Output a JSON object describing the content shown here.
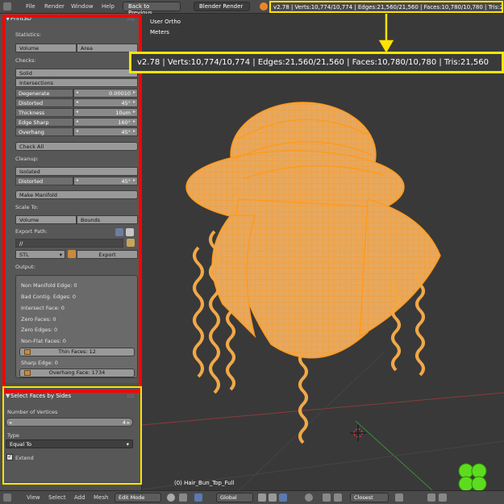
{
  "topbar": {
    "menus": [
      "File",
      "Render",
      "Window",
      "Help"
    ],
    "back_button": "Back to Previous",
    "render_engine": "Blender Render",
    "stats": "v2.78 | Verts:10,774/10,774 | Edges:21,560/21,560 | Faces:10,780/10,780 | Tris:21,560"
  },
  "print3d": {
    "title": "Print3D",
    "statistics_label": "Statistics:",
    "volume_button": "Volume",
    "area_button": "Area",
    "checks_label": "Checks:",
    "solid_button": "Solid",
    "intersections_button": "Intersections",
    "fields": [
      {
        "label": "Degenerate",
        "value": "0.00010"
      },
      {
        "label": "Distorted",
        "value": "45°"
      },
      {
        "label": "Thickness",
        "value": "10um"
      },
      {
        "label": "Edge Sharp",
        "value": "160°"
      },
      {
        "label": "Overhang",
        "value": "45°"
      }
    ],
    "check_all_button": "Check All",
    "cleanup_label": "Cleanup:",
    "isolated_button": "Isolated",
    "distorted_label": "Distorted",
    "distorted_value": "45°",
    "make_manifold_button": "Make Manifold",
    "scale_to_label": "Scale To:",
    "scale_volume_button": "Volume",
    "bounds_button": "Bounds",
    "export_path_label": "Export Path:",
    "export_path_value": "//",
    "format_value": "STL",
    "export_button": "Export",
    "output_label": "Output:",
    "output_lines": [
      "Non Manifold Edge: 0",
      "Bad Contig. Edges: 0",
      "Intersect Face: 0",
      "Zero Faces: 0",
      "Zero Edges: 0",
      "Non-Flat Faces: 0"
    ],
    "thin_faces_button": "Thin Faces: 12",
    "sharp_edge_text": "Sharp Edge: 0",
    "overhang_face_button": "Overhang Face: 1734"
  },
  "operator": {
    "title": "Select Faces by Sides",
    "vertices_label": "Number of Vertices",
    "vertices_value": "4",
    "type_label": "Type",
    "type_value": "Equal To",
    "extend_label": "Extend"
  },
  "viewport": {
    "view_name": "User Ortho",
    "units": "Meters",
    "object_label": "(0) Hair_Bun_Top_Full",
    "stats_zoom": "v2.78 | Verts:10,774/10,774 | Edges:21,560/21,560 | Faces:10,780/10,780 | Tris:21,560"
  },
  "bottombar": {
    "menus": [
      "View",
      "Select",
      "Add",
      "Mesh"
    ],
    "mode": "Edit Mode",
    "orientation": "Global",
    "snap": "Closest"
  },
  "colors": {
    "mesh_fill": "#e7a85e",
    "mesh_wire": "#ff9a1a",
    "highlight_red": "#ff0000",
    "highlight_yellow": "#ffe400",
    "clover": "#5ddc1f"
  }
}
